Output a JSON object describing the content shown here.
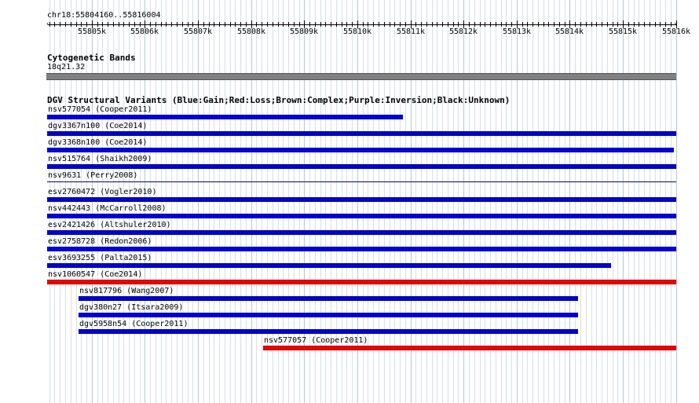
{
  "ruler": {
    "location": "chr18:55804160..55816004",
    "ticks": [
      "55805k",
      "55806k",
      "55807k",
      "55808k",
      "55809k",
      "55810k",
      "55811k",
      "55812k",
      "55813k",
      "55814k",
      "55815k",
      "55816k"
    ]
  },
  "cytoband": {
    "title": "Cytogenetic Bands",
    "band_label": "18q21.32"
  },
  "dgv": {
    "title": "DGV Structural Variants (Blue:Gain;Red:Loss;Brown:Complex;Purple:Inversion;Black:Unknown)",
    "colors": {
      "gain": "#0000dd",
      "loss": "#ee0000"
    },
    "features": [
      {
        "label": "nsv577054 (Cooper2011)",
        "type": "gain",
        "start": 55804160,
        "end": 55810860
      },
      {
        "label": "dgv3367n100 (Coe2014)",
        "type": "gain",
        "start": 55804160,
        "end": 55816004
      },
      {
        "label": "dgv3368n100 (Coe2014)",
        "type": "gain",
        "start": 55804160,
        "end": 55815960
      },
      {
        "label": "nsv515764 (Shaikh2009)",
        "type": "gain",
        "start": 55804160,
        "end": 55816004
      },
      {
        "label": "nsv9631 (Perry2008)",
        "type": "gain",
        "start": 55804160,
        "end": 55816004,
        "thin": true
      },
      {
        "label": "esv2760472 (Vogler2010)",
        "type": "gain",
        "start": 55804160,
        "end": 55816004
      },
      {
        "label": "nsv442443 (McCarroll2008)",
        "type": "gain",
        "start": 55804160,
        "end": 55816004
      },
      {
        "label": "esv2421426 (Altshuler2010)",
        "type": "gain",
        "start": 55804160,
        "end": 55816004
      },
      {
        "label": "esv2758728 (Redon2006)",
        "type": "gain",
        "start": 55804160,
        "end": 55816004
      },
      {
        "label": "esv3693255 (Palta2015)",
        "type": "gain",
        "start": 55804160,
        "end": 55814780
      },
      {
        "label": "nsv1060547 (Coe2014)",
        "type": "loss",
        "start": 55804160,
        "end": 55816004
      },
      {
        "label": "nsv817796 (Wang2007)",
        "type": "gain",
        "start": 55804750,
        "end": 55814150
      },
      {
        "label": "dgv380n27 (Itsara2009)",
        "type": "gain",
        "start": 55804750,
        "end": 55814150
      },
      {
        "label": "dgv5958n54 (Cooper2011)",
        "type": "gain",
        "start": 55804750,
        "end": 55814150
      },
      {
        "label": "nsv577057 (Cooper2011)",
        "type": "loss",
        "start": 55808220,
        "end": 55816004
      }
    ]
  }
}
